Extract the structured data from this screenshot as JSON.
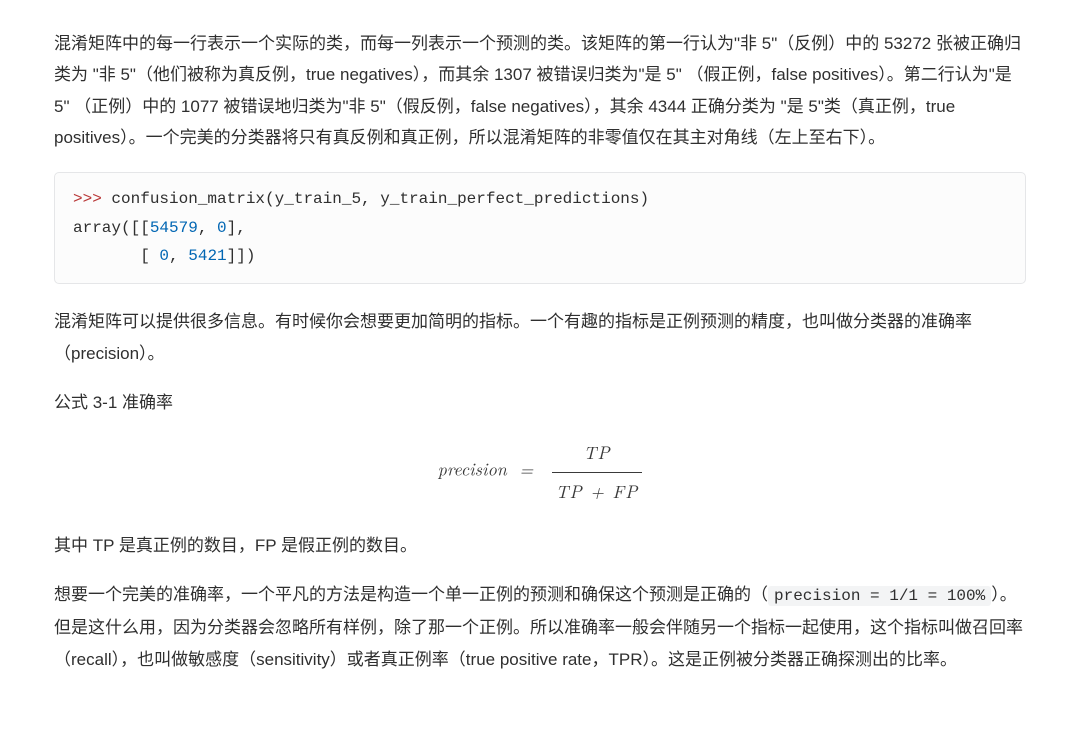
{
  "para1": "混淆矩阵中的每一行表示一个实际的类，而每一列表示一个预测的类。该矩阵的第一行认为\"非 5\"（反例）中的 53272 张被正确归类为 \"非 5\"（他们被称为真反例，true negatives），而其余 1307 被错误归类为\"是 5\" （假正例，false positives）。第二行认为\"是 5\" （正例）中的 1077 被错误地归类为\"非 5\"（假反例，false negatives），其余 4344 正确分类为 \"是 5\"类（真正例，true positives）。一个完美的分类器将只有真反例和真正例，所以混淆矩阵的非零值仅在其主对角线（左上至右下）。",
  "code": {
    "prompt": ">>> ",
    "call": "confusion_matrix(y_train_5, y_train_perfect_predictions)",
    "out_lead": "array([[",
    "n00": "54579",
    "sep1": ", ",
    "n01": "0",
    "out_mid": "],\n       [ ",
    "n10": "0",
    "sep2": ", ",
    "n11": "5421",
    "out_tail": "]])"
  },
  "para2": "混淆矩阵可以提供很多信息。有时候你会想要更加简明的指标。一个有趣的指标是正例预测的精度，也叫做分类器的准确率（precision）。",
  "para3": "公式 3-1 准确率",
  "formula": {
    "lhs": "precision",
    "eq": "=",
    "numerator": "TP",
    "denominator": "TP + FP"
  },
  "para4": "其中 TP 是真正例的数目，FP 是假正例的数目。",
  "para5a": "想要一个完美的准确率，一个平凡的方法是构造一个单一正例的预测和确保这个预测是正确的（",
  "inline_code": "precision = 1/1 = 100%",
  "para5b": "）。但是这什么用，因为分类器会忽略所有样例，除了那一个正例。所以准确率一般会伴随另一个指标一起使用，这个指标叫做召回率（recall），也叫做敏感度（sensitivity）或者真正例率（true positive rate，TPR）。这是正例被分类器正确探测出的比率。"
}
